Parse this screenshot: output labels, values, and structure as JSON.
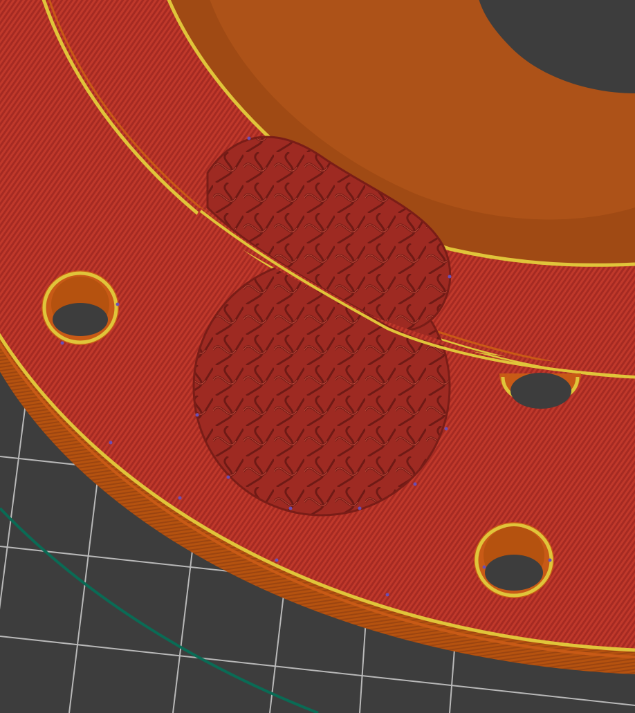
{
  "scene": {
    "kind": "3d-print-slicer-preview",
    "objects": [
      "ring-part",
      "gyroid-infill-region-upper",
      "gyroid-infill-region-lower",
      "mounting-hole-left",
      "mounting-hole-center-right",
      "mounting-hole-bottom",
      "inner-bore",
      "bed-grid",
      "travel-path"
    ]
  },
  "colors": {
    "bed": "#3d3d3d",
    "grid_line": "#cfcfcf",
    "top_solid_infill": "#c0392b",
    "top_solid_stripe": "#a52a22",
    "perimeter_wall": "#c85a16",
    "perimeter_wall_dark": "#8e3f10",
    "external_perimeter": "#e0c53a",
    "gyroid_infill": "#9e2a22",
    "gyroid_line": "#7a1d17",
    "seam_marker": "#6a4fb5",
    "travel_path": "#0a6b55"
  }
}
